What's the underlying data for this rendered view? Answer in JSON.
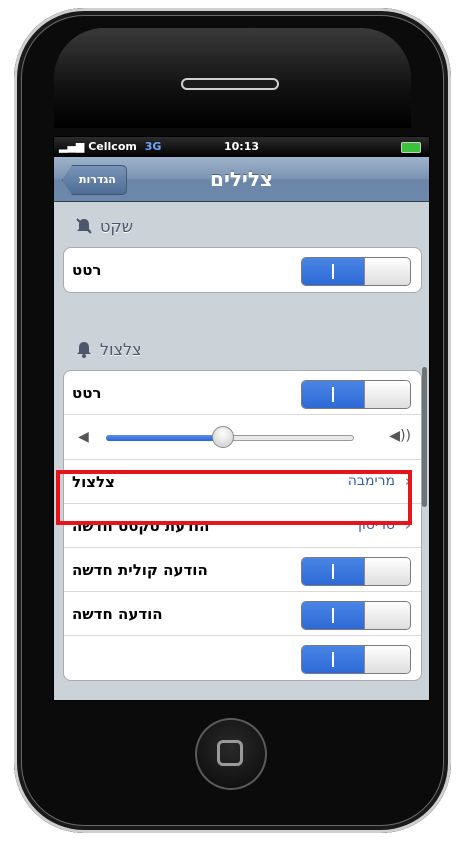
{
  "status": {
    "carrier": "Cellcom",
    "network": "3G",
    "time": "10:13"
  },
  "navbar": {
    "back_label": "הגדרות",
    "title": "צלילים"
  },
  "sections": {
    "silent": {
      "label": "שקט",
      "icon": "bell-slash-icon"
    },
    "ring": {
      "label": "צלצול",
      "icon": "bell-icon"
    }
  },
  "rows": {
    "silent_vibrate": {
      "label": "רטט",
      "on": true
    },
    "ring_vibrate": {
      "label": "רטט",
      "on": true
    },
    "volume": {
      "level": 0.47
    },
    "ringtone": {
      "label": "צלצול",
      "value": "מרימבה"
    },
    "new_text": {
      "label": "הודעת טקסט חדשה",
      "value": "טריטון"
    },
    "new_voicemail": {
      "label": "הודעה קולית חדשה",
      "on": true
    },
    "new_mail": {
      "label": "הודעה חדשה",
      "on": true
    }
  },
  "colors": {
    "highlight": "#e8141b",
    "toggle_on": "#2c6ad6",
    "nav": "#6d88aa"
  }
}
